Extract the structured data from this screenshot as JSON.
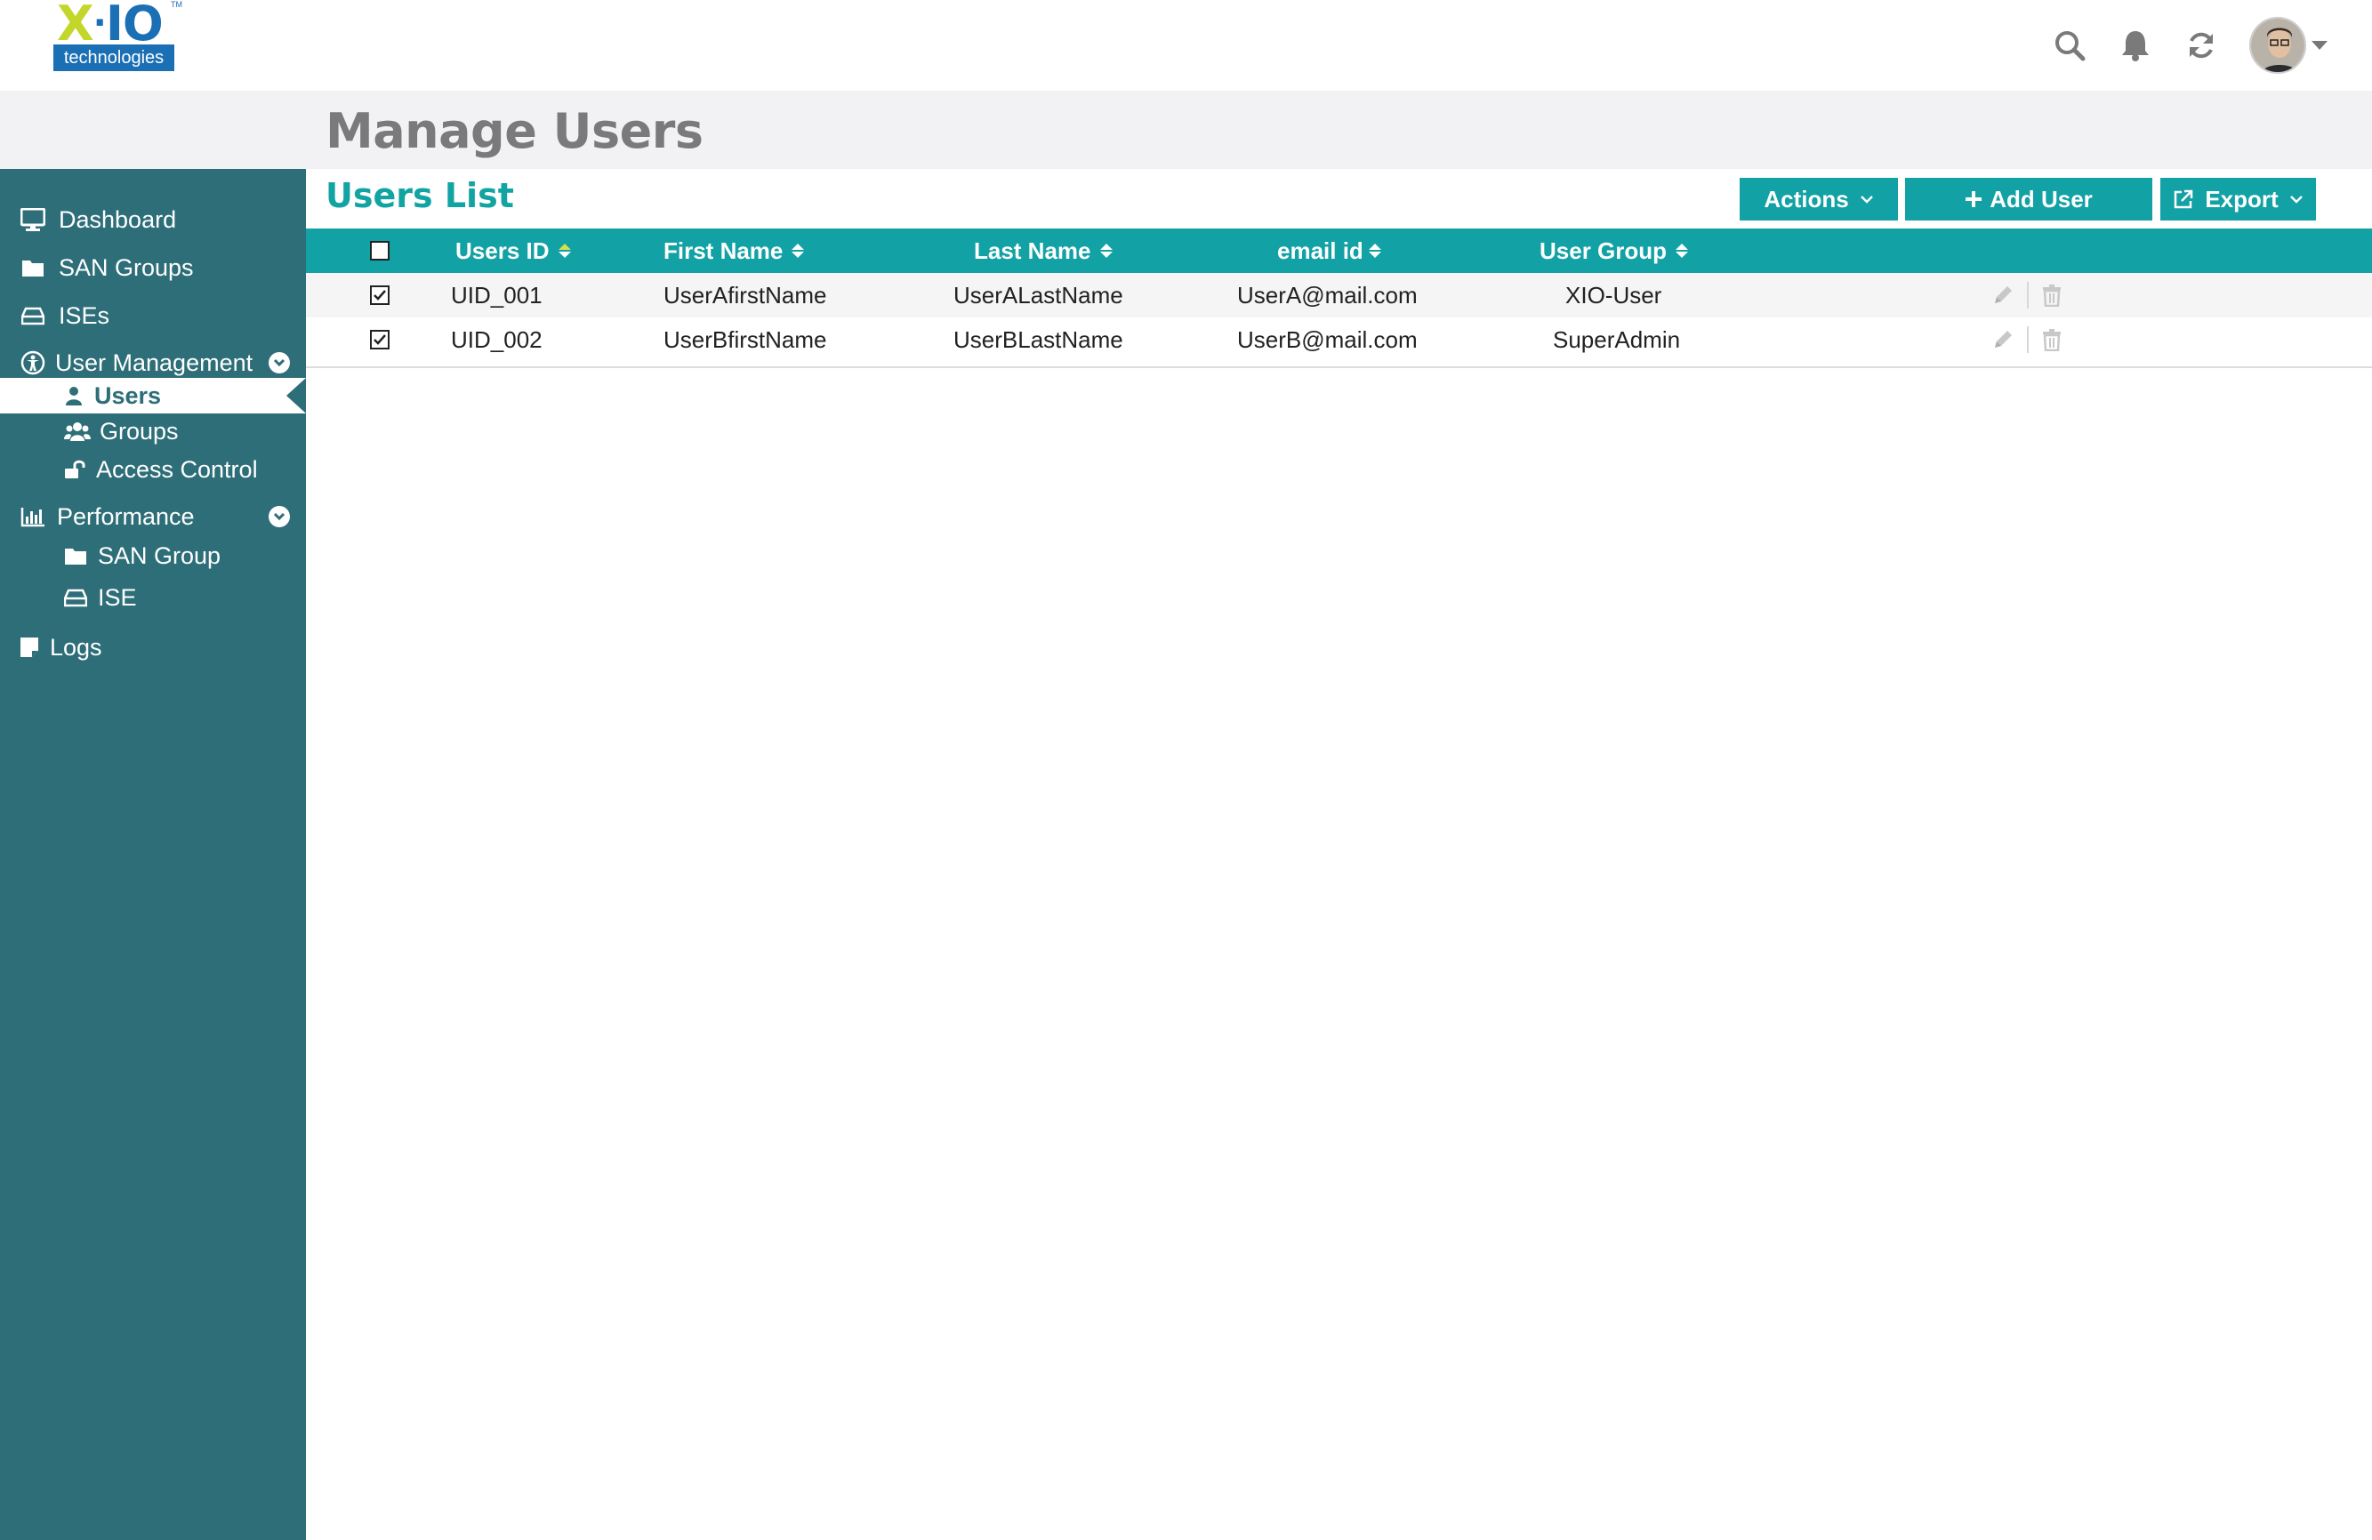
{
  "logo": {
    "top": "X·IO",
    "tm": "TM",
    "bottom": "technologies"
  },
  "header": {
    "title": "Manage Users"
  },
  "topbar": {
    "icons": [
      "search-icon",
      "bell-icon",
      "refresh-icon",
      "user-avatar"
    ]
  },
  "sidebar": {
    "items": [
      {
        "label": "Dashboard",
        "icon": "monitor-icon"
      },
      {
        "label": "SAN Groups",
        "icon": "folder-icon"
      },
      {
        "label": "ISEs",
        "icon": "drive-icon"
      },
      {
        "label": "User Management",
        "icon": "user-management-icon",
        "expanded": true
      },
      {
        "label": "Users",
        "icon": "user-icon",
        "active": true
      },
      {
        "label": "Groups",
        "icon": "users-icon"
      },
      {
        "label": "Access Control",
        "icon": "unlock-icon"
      },
      {
        "label": "Performance",
        "icon": "bar-chart-icon",
        "expanded": true
      },
      {
        "label": "SAN Group",
        "icon": "folder-icon"
      },
      {
        "label": "ISE",
        "icon": "drive-icon"
      },
      {
        "label": "Logs",
        "icon": "note-icon"
      }
    ]
  },
  "main": {
    "section_title": "Users List",
    "buttons": {
      "actions": "Actions",
      "add_user": "Add User",
      "export": "Export"
    },
    "columns": [
      "Users ID",
      "First Name",
      "Last Name",
      "email id",
      "User Group"
    ],
    "rows": [
      {
        "checked": true,
        "id": "UID_001",
        "first": "UserAfirstName",
        "last": "UserALastName",
        "email": "UserA@mail.com",
        "group": "XIO-User"
      },
      {
        "checked": true,
        "id": "UID_002",
        "first": "UserBfirstName",
        "last": "UserBLastName",
        "email": "UserB@mail.com",
        "group": "SuperAdmin"
      }
    ]
  },
  "colors": {
    "teal": "#12a1a4",
    "sidebar": "#2d6e78",
    "brand_blue": "#1b6fb5",
    "brand_green": "#c3d72b",
    "sort_active": "#d6e04a"
  }
}
